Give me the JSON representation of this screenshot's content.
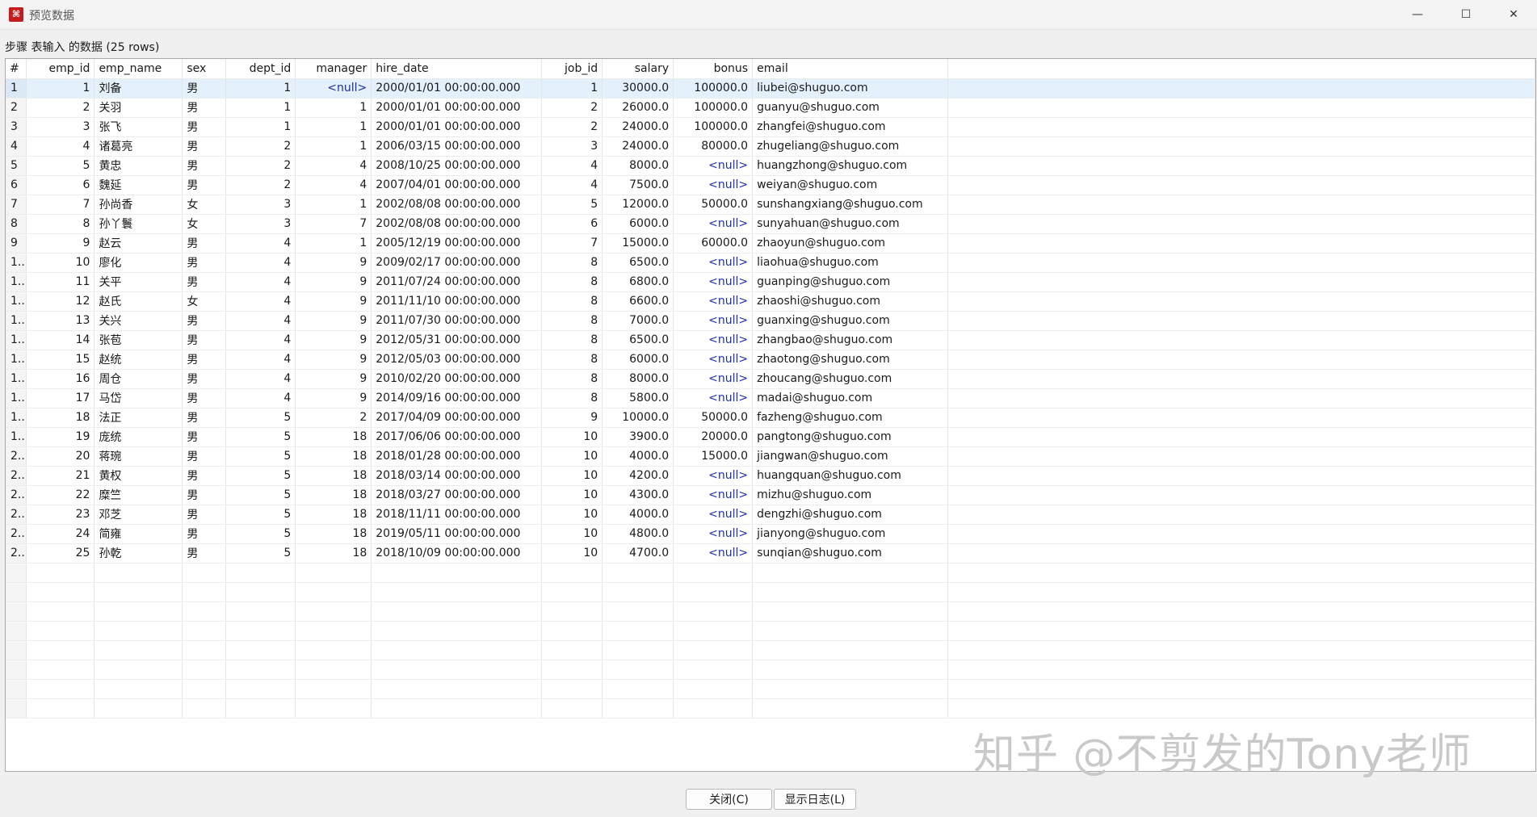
{
  "window": {
    "title": "预览数据",
    "icon": "app-logo-icon",
    "min_glyph": "—",
    "max_glyph": "☐",
    "close_glyph": "✕"
  },
  "header": {
    "step_label": "步骤 表输入 的数据  (25 rows)"
  },
  "table": {
    "columns": [
      "#",
      "emp_id",
      "emp_name",
      "sex",
      "dept_id",
      "manager",
      "hire_date",
      "job_id",
      "salary",
      "bonus",
      "email"
    ],
    "rows": [
      [
        "1",
        "1",
        "刘备",
        "男",
        "1",
        "<null>",
        "2000/01/01 00:00:00.000",
        "1",
        "30000.0",
        "100000.0",
        "liubei@shuguo.com"
      ],
      [
        "2",
        "2",
        "关羽",
        "男",
        "1",
        "1",
        "2000/01/01 00:00:00.000",
        "2",
        "26000.0",
        "100000.0",
        "guanyu@shuguo.com"
      ],
      [
        "3",
        "3",
        "张飞",
        "男",
        "1",
        "1",
        "2000/01/01 00:00:00.000",
        "2",
        "24000.0",
        "100000.0",
        "zhangfei@shuguo.com"
      ],
      [
        "4",
        "4",
        "诸葛亮",
        "男",
        "2",
        "1",
        "2006/03/15 00:00:00.000",
        "3",
        "24000.0",
        "80000.0",
        "zhugeliang@shuguo.com"
      ],
      [
        "5",
        "5",
        "黄忠",
        "男",
        "2",
        "4",
        "2008/10/25 00:00:00.000",
        "4",
        "8000.0",
        "<null>",
        "huangzhong@shuguo.com"
      ],
      [
        "6",
        "6",
        "魏延",
        "男",
        "2",
        "4",
        "2007/04/01 00:00:00.000",
        "4",
        "7500.0",
        "<null>",
        "weiyan@shuguo.com"
      ],
      [
        "7",
        "7",
        "孙尚香",
        "女",
        "3",
        "1",
        "2002/08/08 00:00:00.000",
        "5",
        "12000.0",
        "50000.0",
        "sunshangxiang@shuguo.com"
      ],
      [
        "8",
        "8",
        "孙丫鬟",
        "女",
        "3",
        "7",
        "2002/08/08 00:00:00.000",
        "6",
        "6000.0",
        "<null>",
        "sunyahuan@shuguo.com"
      ],
      [
        "9",
        "9",
        "赵云",
        "男",
        "4",
        "1",
        "2005/12/19 00:00:00.000",
        "7",
        "15000.0",
        "60000.0",
        "zhaoyun@shuguo.com"
      ],
      [
        "1..",
        "10",
        "廖化",
        "男",
        "4",
        "9",
        "2009/02/17 00:00:00.000",
        "8",
        "6500.0",
        "<null>",
        "liaohua@shuguo.com"
      ],
      [
        "1..",
        "11",
        "关平",
        "男",
        "4",
        "9",
        "2011/07/24 00:00:00.000",
        "8",
        "6800.0",
        "<null>",
        "guanping@shuguo.com"
      ],
      [
        "1..",
        "12",
        "赵氏",
        "女",
        "4",
        "9",
        "2011/11/10 00:00:00.000",
        "8",
        "6600.0",
        "<null>",
        "zhaoshi@shuguo.com"
      ],
      [
        "1..",
        "13",
        "关兴",
        "男",
        "4",
        "9",
        "2011/07/30 00:00:00.000",
        "8",
        "7000.0",
        "<null>",
        "guanxing@shuguo.com"
      ],
      [
        "1..",
        "14",
        "张苞",
        "男",
        "4",
        "9",
        "2012/05/31 00:00:00.000",
        "8",
        "6500.0",
        "<null>",
        "zhangbao@shuguo.com"
      ],
      [
        "1..",
        "15",
        "赵统",
        "男",
        "4",
        "9",
        "2012/05/03 00:00:00.000",
        "8",
        "6000.0",
        "<null>",
        "zhaotong@shuguo.com"
      ],
      [
        "1..",
        "16",
        "周仓",
        "男",
        "4",
        "9",
        "2010/02/20 00:00:00.000",
        "8",
        "8000.0",
        "<null>",
        "zhoucang@shuguo.com"
      ],
      [
        "1..",
        "17",
        "马岱",
        "男",
        "4",
        "9",
        "2014/09/16 00:00:00.000",
        "8",
        "5800.0",
        "<null>",
        "madai@shuguo.com"
      ],
      [
        "1..",
        "18",
        "法正",
        "男",
        "5",
        "2",
        "2017/04/09 00:00:00.000",
        "9",
        "10000.0",
        "50000.0",
        "fazheng@shuguo.com"
      ],
      [
        "1..",
        "19",
        "庞统",
        "男",
        "5",
        "18",
        "2017/06/06 00:00:00.000",
        "10",
        "3900.0",
        "20000.0",
        "pangtong@shuguo.com"
      ],
      [
        "2..",
        "20",
        "蒋琬",
        "男",
        "5",
        "18",
        "2018/01/28 00:00:00.000",
        "10",
        "4000.0",
        "15000.0",
        "jiangwan@shuguo.com"
      ],
      [
        "2..",
        "21",
        "黄权",
        "男",
        "5",
        "18",
        "2018/03/14 00:00:00.000",
        "10",
        "4200.0",
        "<null>",
        "huangquan@shuguo.com"
      ],
      [
        "2..",
        "22",
        "糜竺",
        "男",
        "5",
        "18",
        "2018/03/27 00:00:00.000",
        "10",
        "4300.0",
        "<null>",
        "mizhu@shuguo.com"
      ],
      [
        "2..",
        "23",
        "邓芝",
        "男",
        "5",
        "18",
        "2018/11/11 00:00:00.000",
        "10",
        "4000.0",
        "<null>",
        "dengzhi@shuguo.com"
      ],
      [
        "2..",
        "24",
        "简雍",
        "男",
        "5",
        "18",
        "2019/05/11 00:00:00.000",
        "10",
        "4800.0",
        "<null>",
        "jianyong@shuguo.com"
      ],
      [
        "2..",
        "25",
        "孙乾",
        "男",
        "5",
        "18",
        "2018/10/09 00:00:00.000",
        "10",
        "4700.0",
        "<null>",
        "sunqian@shuguo.com"
      ]
    ]
  },
  "buttons": {
    "close": "关闭(C)",
    "show_log": "显示日志(L)"
  },
  "watermark": "知乎 @不剪发的Tony老师",
  "colors": {
    "null_text": "#1c2fa6",
    "selected_row": "#e4f0fb",
    "app_icon": "#c61c1c"
  }
}
